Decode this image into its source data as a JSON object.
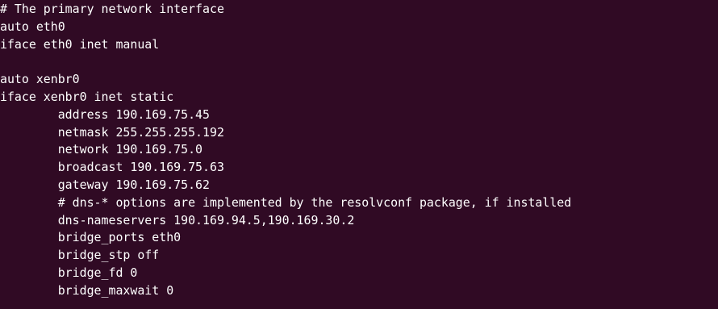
{
  "terminal": {
    "background": "#300a24",
    "foreground": "#ffffff",
    "lines": [
      "# The primary network interface",
      "auto eth0",
      "iface eth0 inet manual",
      "",
      "auto xenbr0",
      "iface xenbr0 inet static",
      "        address 190.169.75.45",
      "        netmask 255.255.255.192",
      "        network 190.169.75.0",
      "        broadcast 190.169.75.63",
      "        gateway 190.169.75.62",
      "        # dns-* options are implemented by the resolvconf package, if installed",
      "        dns-nameservers 190.169.94.5,190.169.30.2",
      "        bridge_ports eth0",
      "        bridge_stp off",
      "        bridge_fd 0",
      "        bridge_maxwait 0"
    ]
  }
}
